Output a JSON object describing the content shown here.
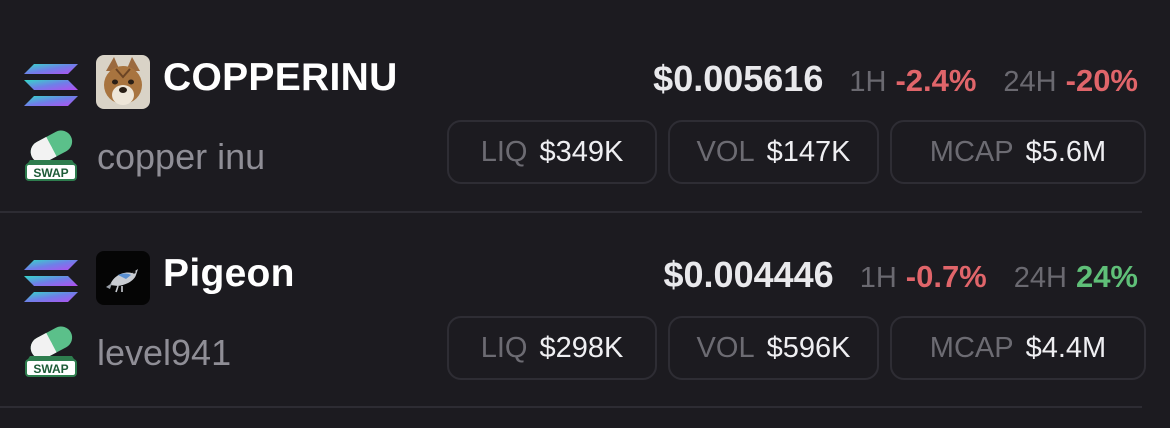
{
  "tokens": [
    {
      "symbol": "COPPERINU",
      "name": "copper inu",
      "price": "$0.005616",
      "change_1h_label": "1H",
      "change_1h": "-2.4%",
      "change_1h_dir": "negative",
      "change_24h_label": "24H",
      "change_24h": "-20%",
      "change_24h_dir": "negative",
      "liq_label": "LIQ",
      "liq": "$349K",
      "vol_label": "VOL",
      "vol": "$147K",
      "mcap_label": "MCAP",
      "mcap": "$5.6M",
      "chain_icon": "solana-icon",
      "dex_icon": "pill-swap-icon",
      "avatar_icon": "shiba-dog-avatar"
    },
    {
      "symbol": "Pigeon",
      "name": "level941",
      "price": "$0.004446",
      "change_1h_label": "1H",
      "change_1h": "-0.7%",
      "change_1h_dir": "negative",
      "change_24h_label": "24H",
      "change_24h": "24%",
      "change_24h_dir": "positive",
      "liq_label": "LIQ",
      "liq": "$298K",
      "vol_label": "VOL",
      "vol": "$596K",
      "mcap_label": "MCAP",
      "mcap": "$4.4M",
      "chain_icon": "solana-icon",
      "dex_icon": "pill-swap-icon",
      "avatar_icon": "pigeon-bird-avatar"
    }
  ],
  "dex_badge_text": "SWAP",
  "colors": {
    "background": "#1c1b20",
    "negative": "#e0656a",
    "positive": "#5fbf78",
    "muted": "#6a6970"
  }
}
